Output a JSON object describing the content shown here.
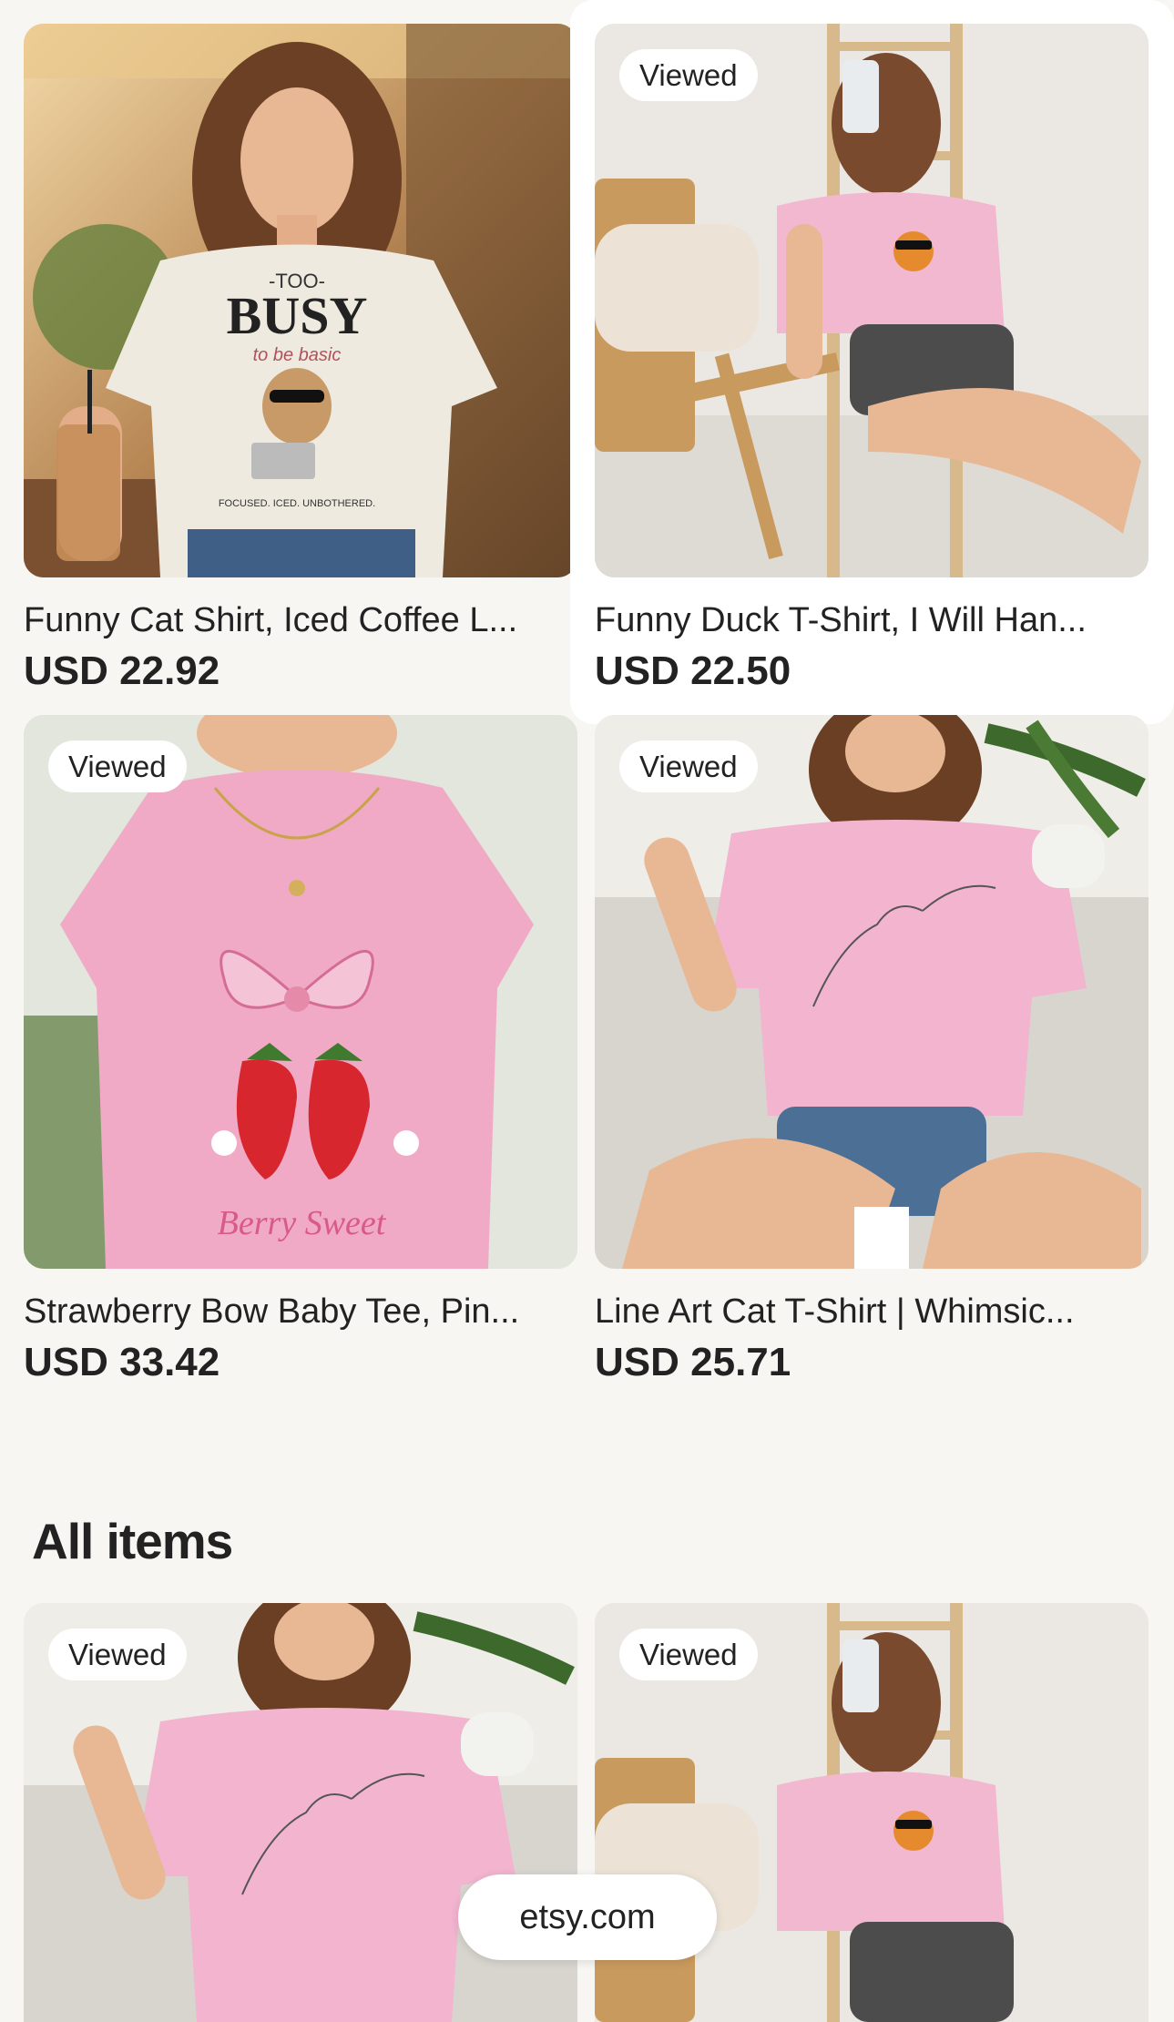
{
  "listings": [
    {
      "title": "Funny Cat Shirt, Iced Coffee L...",
      "price": "USD 22.92",
      "badge": "",
      "shirt_color": "#eeeae0",
      "shirt_text_main": "BUSY",
      "shirt_text_top": "-TOO-",
      "shirt_text_sub": "to be basic",
      "shirt_text_bottom": "FOCUSED. ICED. UNBOTHERED."
    },
    {
      "title": "Funny Duck T-Shirt, I Will Han...",
      "price": "USD 22.50",
      "badge": "Viewed",
      "shirt_color": "#f2b8cf"
    },
    {
      "title": "Strawberry Bow Baby Tee, Pin...",
      "price": "USD 33.42",
      "badge": "Viewed",
      "shirt_color": "#f0aac6",
      "shirt_text_main": "Berry Sweet"
    },
    {
      "title": "Line Art Cat T-Shirt | Whimsic...",
      "price": "USD 25.71",
      "badge": "Viewed",
      "shirt_color": "#f2b4cf"
    }
  ],
  "all_items": {
    "heading": "All items",
    "listings": [
      {
        "badge": "Viewed",
        "shirt_color": "#f2b4cf"
      },
      {
        "badge": "Viewed",
        "shirt_color": "#f2b8cf"
      }
    ]
  },
  "browser": {
    "url": "etsy.com"
  }
}
